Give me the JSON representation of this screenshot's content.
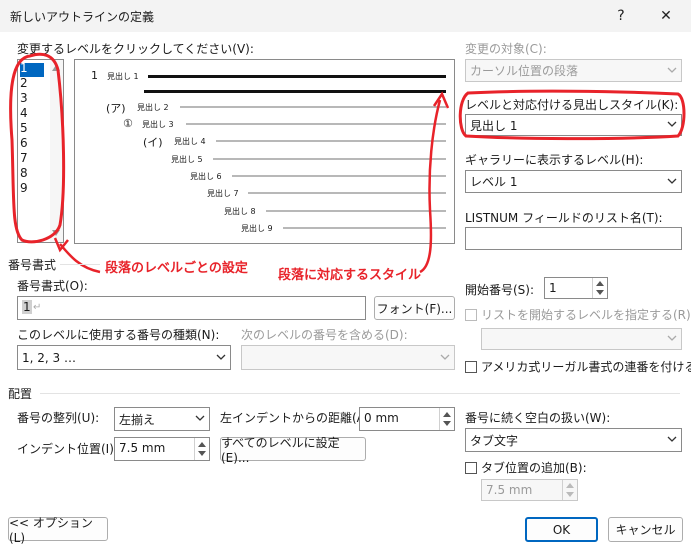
{
  "window": {
    "title": "新しいアウトラインの定義",
    "help": "?",
    "close": "✕"
  },
  "levels_label": "変更するレベルをクリックしてください(V):",
  "levels": [
    "1",
    "2",
    "3",
    "4",
    "5",
    "6",
    "7",
    "8",
    "9"
  ],
  "preview": [
    {
      "prefix": "1",
      "label": "見出し 1"
    },
    {
      "prefix": "(ア)",
      "label": "見出し 2"
    },
    {
      "prefix": "①",
      "label": "見出し 3"
    },
    {
      "prefix": "(イ)",
      "label": "見出し 4"
    },
    {
      "prefix": "",
      "label": "見出し 5"
    },
    {
      "prefix": "",
      "label": "見出し 6"
    },
    {
      "prefix": "",
      "label": "見出し 7"
    },
    {
      "prefix": "",
      "label": "見出し 8"
    },
    {
      "prefix": "",
      "label": "見出し 9"
    }
  ],
  "apply_to": {
    "label": "変更の対象(C):",
    "value": "カーソル位置の段落"
  },
  "link_style": {
    "label": "レベルと対応付ける見出しスタイル(K):",
    "value": "見出し 1"
  },
  "gallery_level": {
    "label": "ギャラリーに表示するレベル(H):",
    "value": "レベル 1"
  },
  "listnum": {
    "label": "LISTNUM フィールドのリスト名(T):",
    "value": ""
  },
  "annotations": {
    "paragraph_level": "段落のレベルごとの設定",
    "paragraph_style": "段落に対応するスタイル"
  },
  "number_format": {
    "section": "番号書式",
    "format_label": "番号書式(O):",
    "format_value": "1",
    "font_button": "フォント(F)...",
    "style_label": "このレベルに使用する番号の種類(N):",
    "style_value": "1, 2, 3 …",
    "include_label": "次のレベルの番号を含める(D):",
    "include_value": ""
  },
  "start_at": {
    "label": "開始番号(S):",
    "value": "1"
  },
  "restart": {
    "label": "リストを開始するレベルを指定する(R):",
    "value": ""
  },
  "legal": {
    "label": "アメリカ式リーガル書式の連番を付ける(G)"
  },
  "position": {
    "section": "配置",
    "alignment_label": "番号の整列(U):",
    "alignment_value": "左揃え",
    "aligned_at_label": "左インデントからの距離(A):",
    "aligned_at_value": "0 mm",
    "indent_label": "インデント位置(I):",
    "indent_value": "7.5 mm",
    "set_all_button": "すべてのレベルに設定(E)..."
  },
  "follow": {
    "label": "番号に続く空白の扱い(W):",
    "value": "タブ文字"
  },
  "tab_stop": {
    "label": "タブ位置の追加(B):",
    "value": "7.5 mm"
  },
  "footer": {
    "options_button": "<< オプション(L)",
    "ok_button": "OK",
    "cancel_button": "キャンセル"
  },
  "colors": {
    "accent": "#0067c0",
    "annotation": "#e8232a"
  }
}
